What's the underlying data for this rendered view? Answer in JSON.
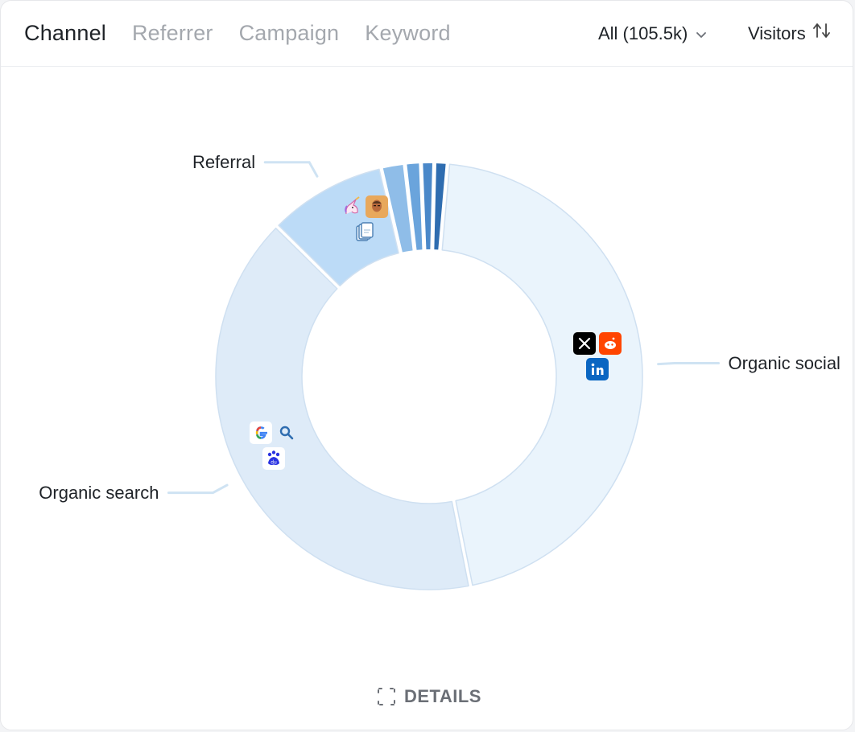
{
  "tabs": [
    {
      "label": "Channel",
      "active": true
    },
    {
      "label": "Referrer",
      "active": false
    },
    {
      "label": "Campaign",
      "active": false
    },
    {
      "label": "Keyword",
      "active": false
    }
  ],
  "filter": {
    "label": "All (105.5k)",
    "icon": "chevron-down-icon"
  },
  "metric": {
    "label": "Visitors",
    "icon": "sort-arrows-icon"
  },
  "details": {
    "label": "DETAILS",
    "icon": "expand-icon"
  },
  "chart_data": {
    "type": "pie",
    "title": "",
    "slices": [
      {
        "label": "Organic social",
        "value": 45.5,
        "color": "#eaf4fc",
        "icons": [
          "x-icon",
          "reddit-icon",
          "linkedin-icon"
        ]
      },
      {
        "label": "Organic search",
        "value": 40.5,
        "color": "#deebf8",
        "icons": [
          "google-icon",
          "search-engine-icon",
          "baidu-icon"
        ]
      },
      {
        "label": "Referral",
        "value": 9.0,
        "color": "#bcdbf7",
        "icons": [
          "unicorn-icon",
          "person-avatar-icon",
          "document-stack-icon"
        ]
      },
      {
        "label": "",
        "value": 1.8,
        "color": "#8fbde8",
        "icons": []
      },
      {
        "label": "",
        "value": 1.2,
        "color": "#6aa4dc",
        "icons": []
      },
      {
        "label": "",
        "value": 1.0,
        "color": "#4a88c9",
        "icons": []
      },
      {
        "label": "",
        "value": 1.0,
        "color": "#2f6db0",
        "icons": []
      }
    ]
  }
}
